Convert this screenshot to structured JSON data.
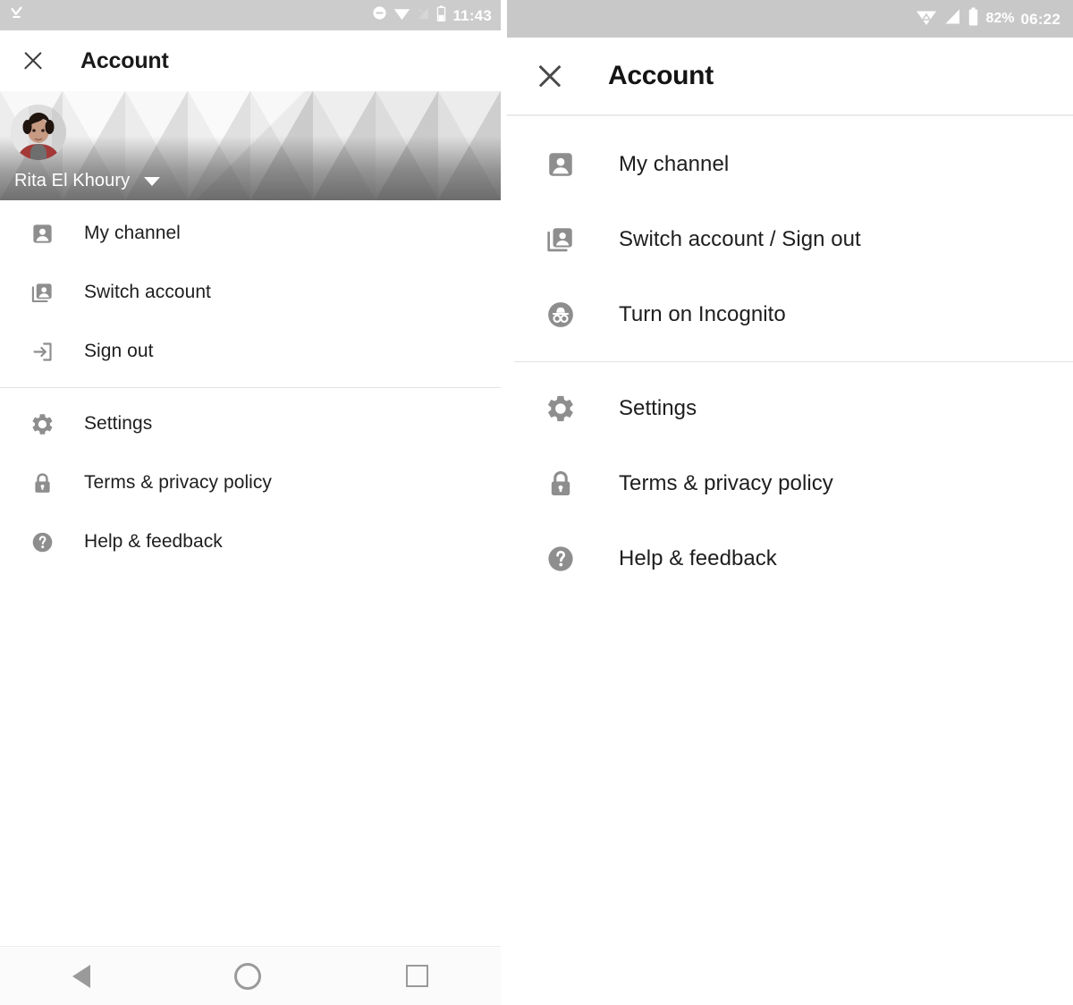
{
  "left_panel": {
    "status_bar": {
      "download_icon": "download-done-icon",
      "dnd_icon": "do-not-disturb-icon",
      "wifi_icon": "wifi-icon",
      "signal_icon": "signal-off-icon",
      "battery_icon": "battery-icon",
      "time": "11:43"
    },
    "app_bar": {
      "close_icon": "close-icon",
      "title": "Account"
    },
    "banner": {
      "avatar_icon": "user-avatar",
      "account_name": "Rita El Khoury",
      "dropdown_icon": "caret-down-icon"
    },
    "menu_group_1": [
      {
        "icon": "account-box-icon",
        "label": "My channel"
      },
      {
        "icon": "switch-account-icon",
        "label": "Switch account"
      },
      {
        "icon": "sign-out-icon",
        "label": "Sign out"
      }
    ],
    "menu_group_2": [
      {
        "icon": "gear-icon",
        "label": "Settings"
      },
      {
        "icon": "lock-icon",
        "label": "Terms & privacy policy"
      },
      {
        "icon": "help-circle-icon",
        "label": "Help & feedback"
      }
    ],
    "nav_bar": {
      "back_icon": "back-triangle-icon",
      "home_icon": "home-circle-icon",
      "recents_icon": "recents-square-icon"
    }
  },
  "right_panel": {
    "status_bar": {
      "wifi_icon": "wifi-icon",
      "signal_icon": "signal-bars-icon",
      "battery_icon": "battery-icon",
      "battery_percent": "82%",
      "time": "06:22"
    },
    "app_bar": {
      "close_icon": "close-icon",
      "title": "Account"
    },
    "menu_group_1": [
      {
        "icon": "account-box-icon",
        "label": "My channel"
      },
      {
        "icon": "switch-account-icon",
        "label": "Switch account / Sign out"
      },
      {
        "icon": "incognito-icon",
        "label": "Turn on Incognito"
      }
    ],
    "menu_group_2": [
      {
        "icon": "gear-icon",
        "label": "Settings"
      },
      {
        "icon": "lock-icon",
        "label": "Terms & privacy policy"
      },
      {
        "icon": "help-circle-icon",
        "label": "Help & feedback"
      }
    ]
  },
  "colors": {
    "status_bar_bg": "#cccccc",
    "icon_gray": "#8e8e8e",
    "text_primary": "#1e1e1e",
    "divider": "#e4e4e4",
    "nav_icon": "#9a9a9a"
  }
}
